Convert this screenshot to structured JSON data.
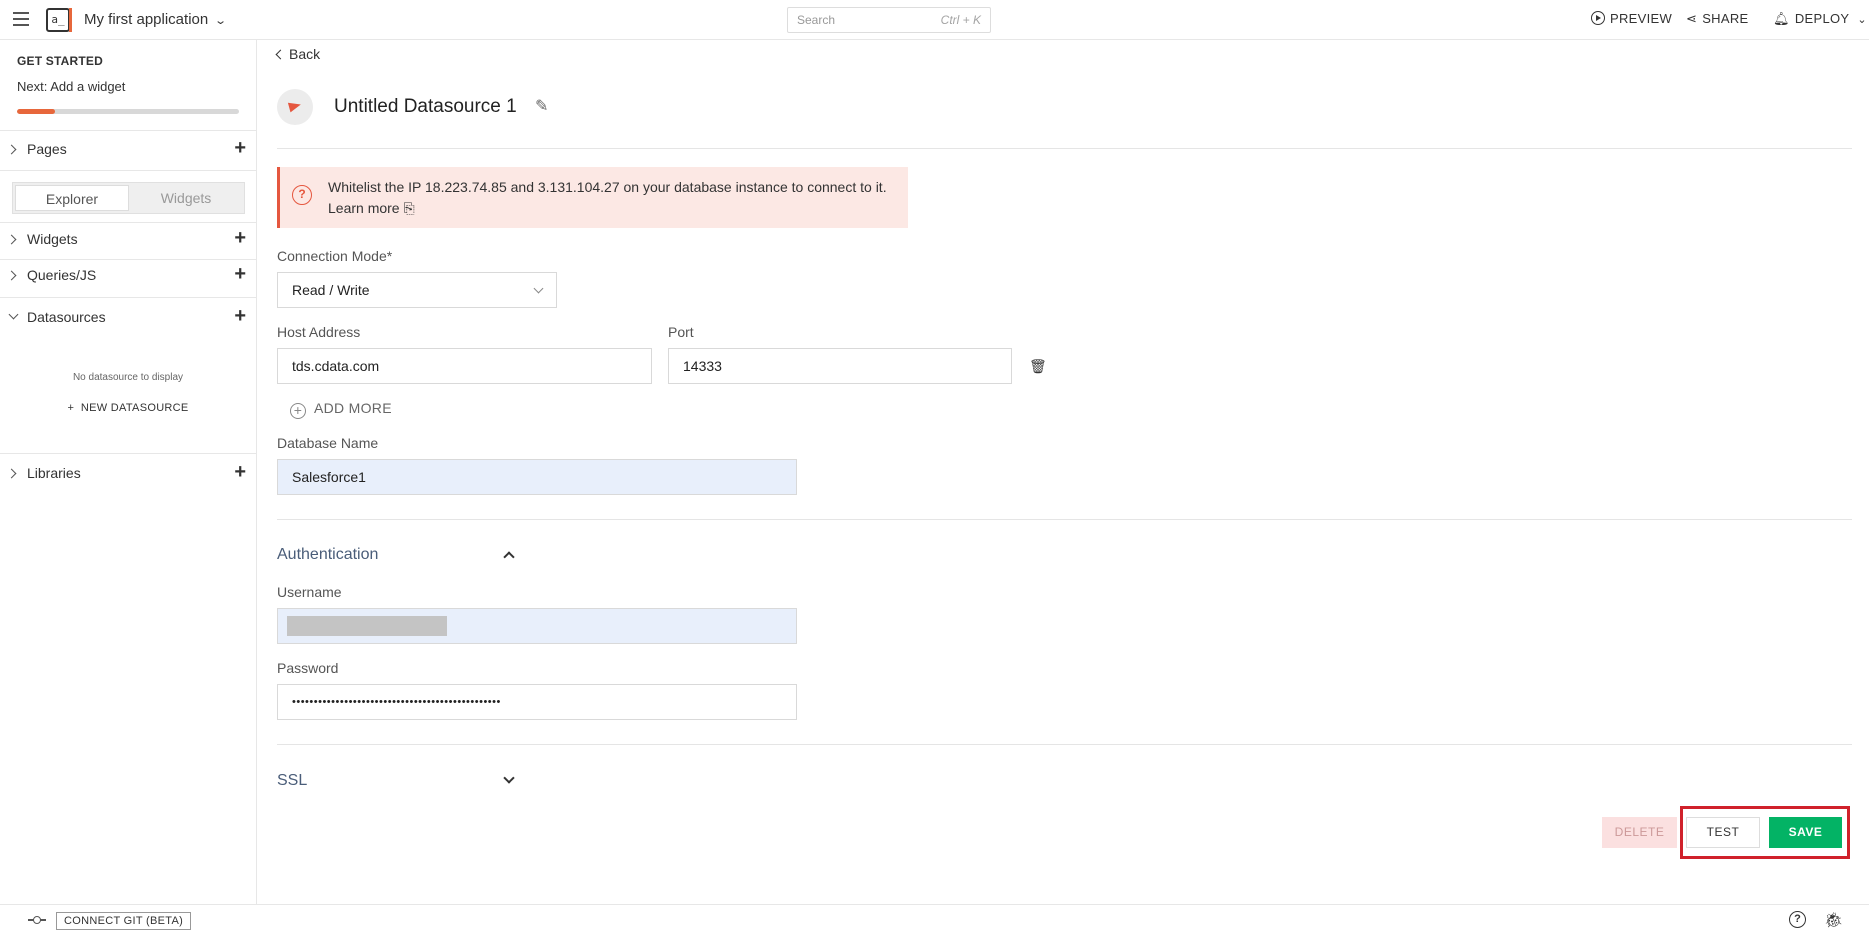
{
  "topbar": {
    "app_name": "My first application",
    "search_placeholder": "Search",
    "search_shortcut": "Ctrl + K",
    "preview_label": "PREVIEW",
    "share_label": "SHARE",
    "deploy_label": "DEPLOY"
  },
  "sidebar": {
    "get_started_title": "GET STARTED",
    "next_step": "Next: Add a widget",
    "progress": 0.17,
    "pages_label": "Pages",
    "explorer_tab": "Explorer",
    "widgets_tab": "Widgets",
    "widgets_label": "Widgets",
    "queries_label": "Queries/JS",
    "datasources_label": "Datasources",
    "no_datasource_text": "No datasource to display",
    "new_datasource_label": "NEW DATASOURCE",
    "libraries_label": "Libraries"
  },
  "main": {
    "back_label": "Back",
    "datasource_title": "Untitled Datasource 1",
    "alert_message": "Whitelist the IP 18.223.74.85 and 3.131.104.27 on your database instance to connect to it.",
    "alert_link": "Learn more",
    "connection_mode_label": "Connection Mode*",
    "connection_mode_value": "Read / Write",
    "host_label": "Host Address",
    "host_value": "tds.cdata.com",
    "port_label": "Port",
    "port_value": "14333",
    "add_more_label": "ADD MORE",
    "dbname_label": "Database Name",
    "dbname_value": "Salesforce1",
    "auth_section": "Authentication",
    "username_label": "Username",
    "password_label": "Password",
    "password_value": "••••••••••••••••••••••••••••••••••••••••••••••••",
    "ssl_section": "SSL",
    "delete_label": "DELETE",
    "test_label": "TEST",
    "save_label": "SAVE"
  },
  "bottombar": {
    "connect_git_label": "CONNECT GIT (BETA)"
  },
  "colors": {
    "accent": "#e7673b",
    "save_green": "#03b365",
    "alert_bg": "#fce8e4",
    "highlight_red": "#d0212b"
  }
}
